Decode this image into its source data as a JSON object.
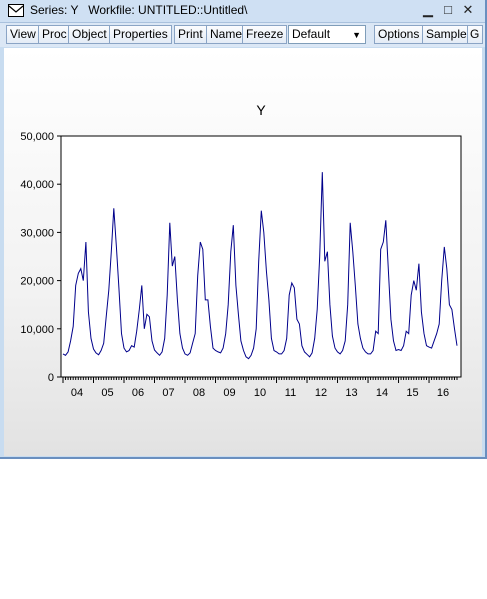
{
  "window": {
    "title": "Series: Y   Workfile: UNTITLED::Untitled\\",
    "minimize": "▁",
    "maximize": "□",
    "close": "✕"
  },
  "toolbar": {
    "buttons": [
      "View",
      "Proc",
      "Object",
      "Properties",
      "Print",
      "Name",
      "Freeze",
      "Options",
      "Sample",
      "G"
    ],
    "freq_select": "Default"
  },
  "colors": {
    "series_line": "#00008b",
    "window_chrome": "#cfe0f3"
  },
  "chart_data": {
    "type": "line",
    "title": "Y",
    "xlabel": "",
    "ylabel": "",
    "ylim": [
      0,
      50000
    ],
    "yticks": [
      "0",
      "10,000",
      "20,000",
      "30,000",
      "40,000",
      "50,000"
    ],
    "ytick_values": [
      0,
      10000,
      20000,
      30000,
      40000,
      50000
    ],
    "x_tick_labels": [
      "04",
      "05",
      "06",
      "07",
      "08",
      "09",
      "10",
      "11",
      "12",
      "13",
      "14",
      "15",
      "16"
    ],
    "frequency": "monthly",
    "start": "2004-01",
    "grid": false,
    "legend": "none",
    "series": [
      {
        "values": [
          4800,
          4500,
          5200,
          7500,
          10500,
          19000,
          21500,
          22500,
          20000,
          28000,
          13500,
          8000,
          5800,
          5000,
          4600,
          5500,
          7000,
          12500,
          18000,
          26000,
          35000,
          27000,
          18500,
          9000,
          6000,
          5200,
          5500,
          6500,
          6200,
          9500,
          14000,
          19000,
          10000,
          13000,
          12500,
          7500,
          5600,
          5000,
          4500,
          5200,
          8000,
          17000,
          32000,
          23000,
          25000,
          16000,
          9000,
          6000,
          4800,
          4500,
          5000,
          7000,
          9000,
          21000,
          28000,
          26500,
          16000,
          16000,
          10500,
          6000,
          5500,
          5200,
          5000,
          6000,
          9000,
          15000,
          26000,
          31500,
          19000,
          13000,
          7500,
          5500,
          4200,
          3800,
          4500,
          6000,
          10000,
          24000,
          34500,
          30000,
          22000,
          16000,
          8000,
          5500,
          5200,
          4800,
          4800,
          5500,
          8000,
          17000,
          19500,
          18500,
          12000,
          11000,
          6500,
          5200,
          4700,
          4200,
          5000,
          8000,
          14000,
          25000,
          42500,
          24000,
          26000,
          15000,
          8500,
          6000,
          5200,
          4800,
          5500,
          7500,
          15000,
          32000,
          26000,
          19000,
          11000,
          8000,
          6000,
          5200,
          4800,
          4800,
          5500,
          9500,
          9000,
          26500,
          28000,
          32500,
          22000,
          12000,
          7500,
          5500,
          5700,
          5500,
          6500,
          9500,
          9000,
          17000,
          20000,
          18000,
          23500,
          13500,
          9000,
          6500,
          6200,
          6000,
          7500,
          9000,
          11000,
          20000,
          27000,
          22500,
          15000,
          14000,
          10000,
          6500
        ]
      }
    ]
  }
}
